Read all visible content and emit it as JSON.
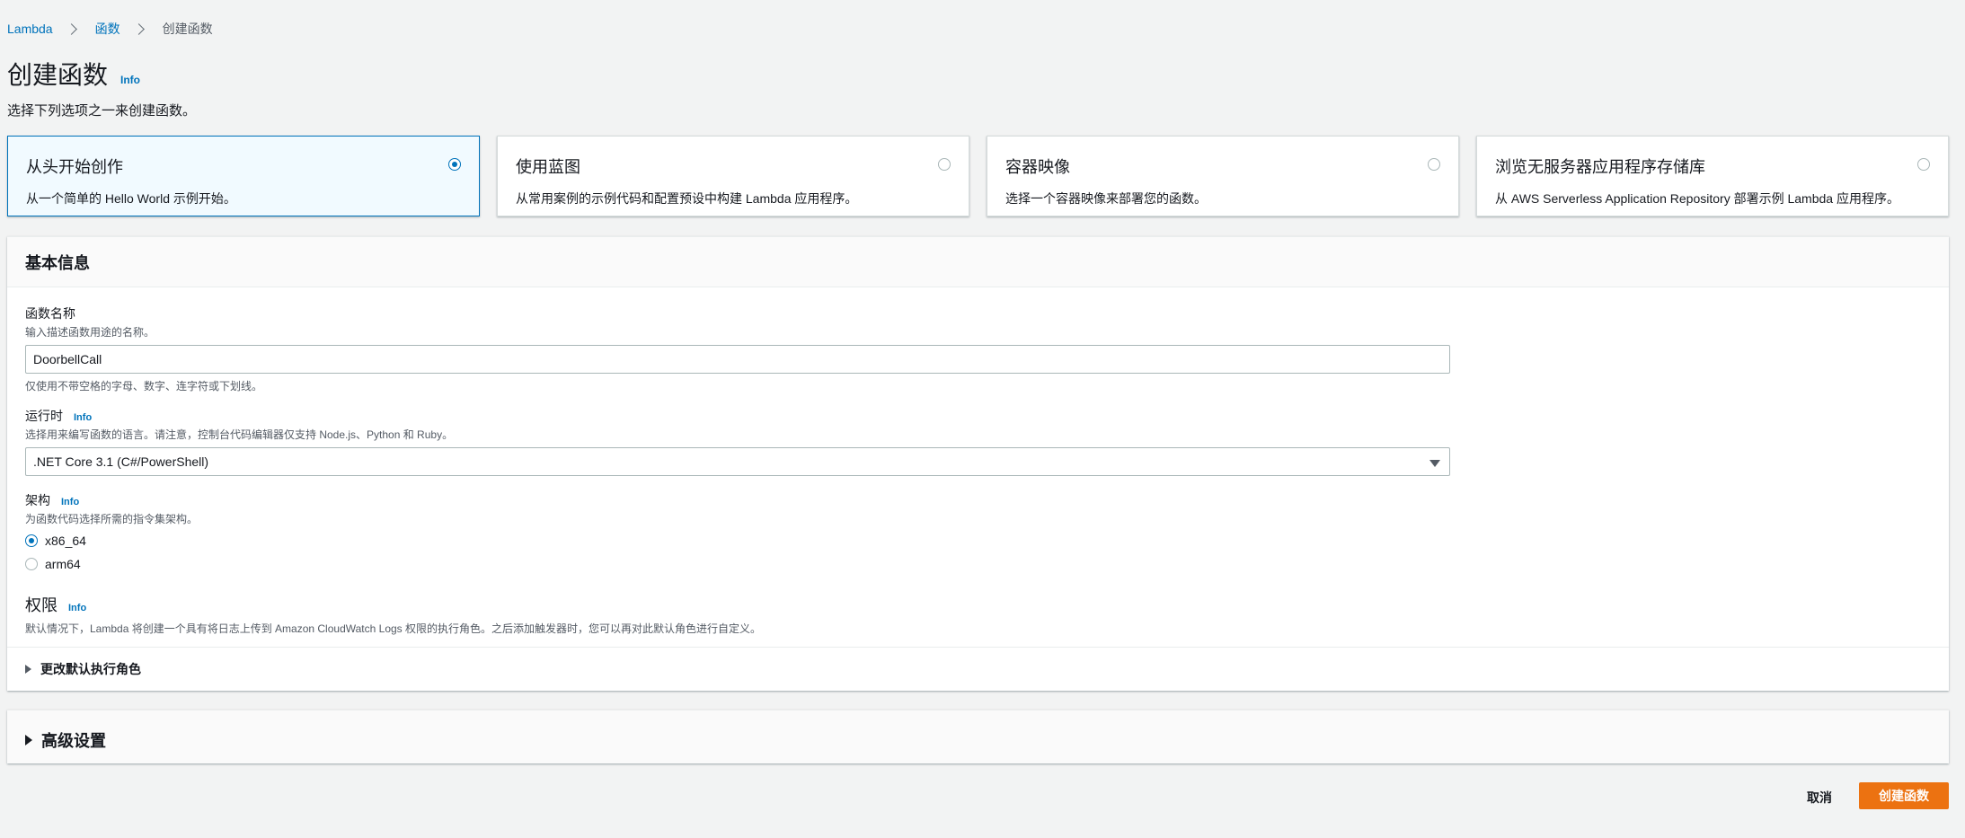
{
  "breadcrumb": {
    "items": [
      "Lambda",
      "函数"
    ],
    "current": "创建函数"
  },
  "page": {
    "title": "创建函数",
    "info": "Info",
    "description": "选择下列选项之一来创建函数。"
  },
  "options": [
    {
      "title": "从头开始创作",
      "description": "从一个简单的 Hello World 示例开始。",
      "selected": true
    },
    {
      "title": "使用蓝图",
      "description": "从常用案例的示例代码和配置预设中构建 Lambda 应用程序。",
      "selected": false
    },
    {
      "title": "容器映像",
      "description": "选择一个容器映像来部署您的函数。",
      "selected": false
    },
    {
      "title": "浏览无服务器应用程序存储库",
      "description": "从 AWS Serverless Application Repository 部署示例 Lambda 应用程序。",
      "selected": false
    }
  ],
  "basic": {
    "header": "基本信息",
    "function_name": {
      "label": "函数名称",
      "description": "输入描述函数用途的名称。",
      "value": "DoorbellCall",
      "constraint": "仅使用不带空格的字母、数字、连字符或下划线。"
    },
    "runtime": {
      "label": "运行时",
      "info": "Info",
      "description": "选择用来编写函数的语言。请注意，控制台代码编辑器仅支持 Node.js、Python 和 Ruby。",
      "value": ".NET Core 3.1 (C#/PowerShell)"
    },
    "architecture": {
      "label": "架构",
      "info": "Info",
      "description": "为函数代码选择所需的指令集架构。",
      "options": [
        {
          "label": "x86_64",
          "selected": true
        },
        {
          "label": "arm64",
          "selected": false
        }
      ]
    },
    "permissions": {
      "label": "权限",
      "info": "Info",
      "description": "默认情况下，Lambda 将创建一个具有将日志上传到 Amazon CloudWatch Logs 权限的执行角色。之后添加触发器时，您可以再对此默认角色进行自定义。",
      "expander": "更改默认执行角色"
    }
  },
  "advanced": {
    "label": "高级设置"
  },
  "footer": {
    "cancel": "取消",
    "create": "创建函数"
  },
  "colors": {
    "accent": "#0073bb",
    "primary_button": "#ec7211",
    "background": "#f2f3f3"
  }
}
